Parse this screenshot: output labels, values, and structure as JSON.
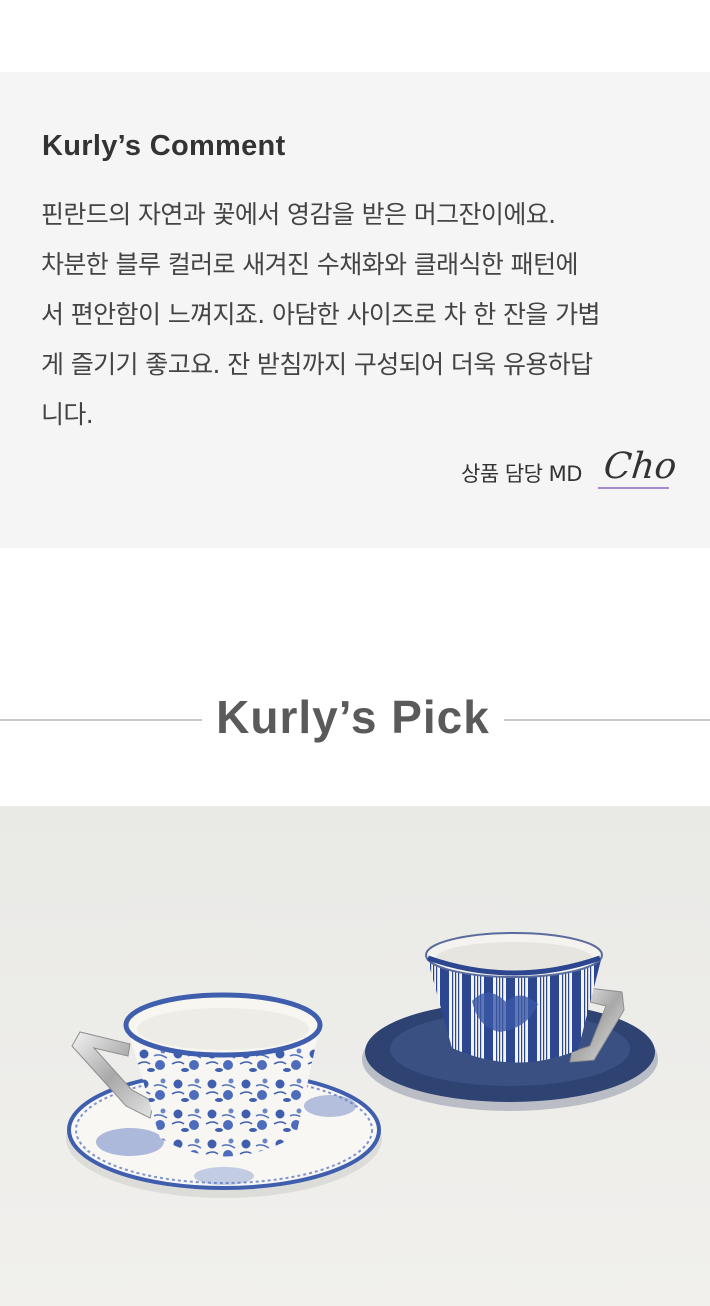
{
  "comment": {
    "title": "Kurly’s Comment",
    "lines": [
      "핀란드의 자연과 꽃에서 영감을 받은 머그잔이에요.",
      "차분한 블루 컬러로 새겨진 수채화와 클래식한 패턴에",
      "서 편안함이 느껴지죠. 아담한 사이즈로 차 한 잔을 가볍",
      "게 즐기기 좋고요. 잔 받침까지 구성되어 더욱 유용하답",
      "니다."
    ],
    "md_label": "상품 담당 MD",
    "signature": "Cho"
  },
  "pick": {
    "title": "Kurly’s Pick"
  },
  "colors": {
    "comment_bg": "#f5f5f5",
    "signature_underline": "#a78bcf",
    "pattern_blue": "#3f5fae",
    "navy_saucer": "#2f4372"
  }
}
